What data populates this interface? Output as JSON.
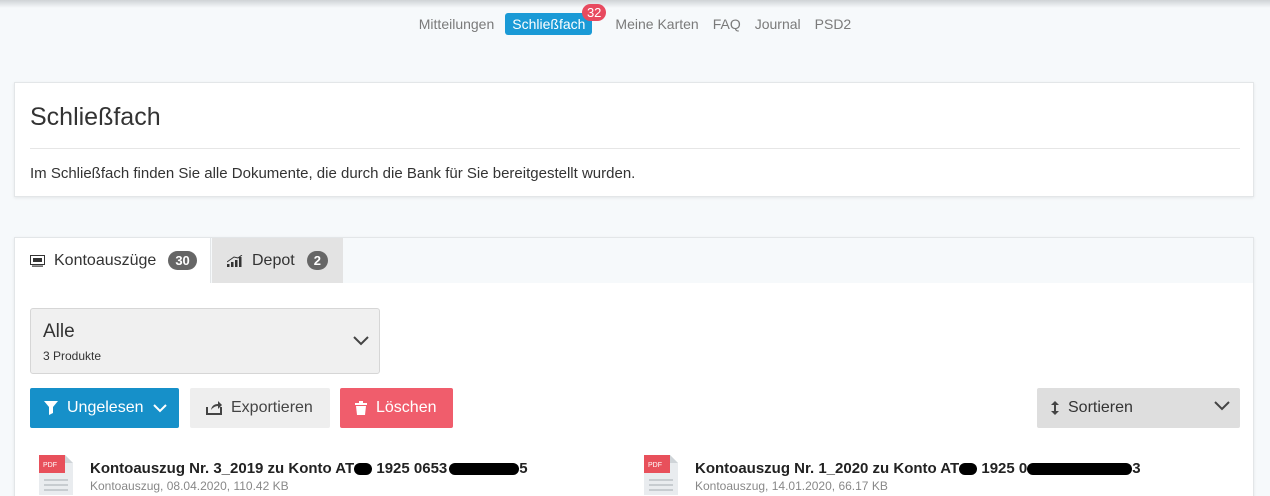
{
  "nav": {
    "items": [
      {
        "label": "Mitteilungen"
      },
      {
        "label": "Schließfach",
        "active": true,
        "badge": "32"
      },
      {
        "label": "Meine Karten"
      },
      {
        "label": "FAQ"
      },
      {
        "label": "Journal"
      },
      {
        "label": "PSD2"
      }
    ]
  },
  "intro": {
    "title": "Schließfach",
    "text": "Im Schließfach finden Sie alle Dokumente, die durch die Bank für Sie bereitgestellt wurden."
  },
  "tabs": [
    {
      "label": "Kontoauszüge",
      "count": "30",
      "icon": "statement-icon"
    },
    {
      "label": "Depot",
      "count": "2",
      "icon": "chart-bars-icon"
    }
  ],
  "filter": {
    "value": "Alle",
    "subtitle": "3 Produkte"
  },
  "actions": {
    "unread": "Ungelesen",
    "export": "Exportieren",
    "delete": "Löschen",
    "sort": "Sortieren"
  },
  "colors": {
    "accent": "#1a9ad6",
    "badge": "#e84a5f",
    "delete": "#f05d6c"
  },
  "documents": [
    {
      "title_a": "Kontoauszug Nr. 3_2019 zu Konto AT",
      "title_b": " 1925 0653",
      "title_c": "5",
      "meta": "Kontoauszug, 08.04.2020, 110.42 KB"
    },
    {
      "title_a": "Kontoauszug Nr. 1_2020 zu Konto AT",
      "title_b": " 1925 0",
      "title_c": "3",
      "meta": "Kontoauszug, 14.01.2020, 66.17 KB"
    }
  ]
}
